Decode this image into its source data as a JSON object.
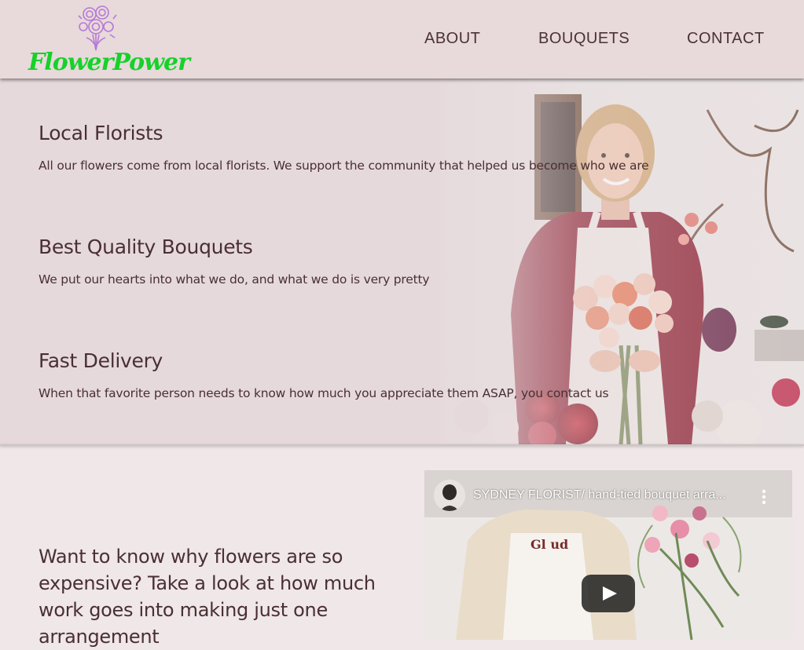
{
  "header": {
    "logo_text": "FlowerPower",
    "nav": [
      {
        "label": "ABOUT"
      },
      {
        "label": "BOUQUETS"
      },
      {
        "label": "CONTACT"
      }
    ]
  },
  "features": [
    {
      "title": "Local Florists",
      "text": "All our flowers come from local florists. We support the community that helped us become who we are"
    },
    {
      "title": "Best Quality Bouquets",
      "text": "We put our hearts into what we do, and what we do is very pretty"
    },
    {
      "title": "Fast Delivery",
      "text": "When that favorite person needs to know how much you appreciate them ASAP, you contact us"
    }
  ],
  "promo": {
    "text": "Want to know why flowers are so expensive? Take a look at how much work goes into making just one arrangement"
  },
  "video": {
    "title": "SYDNEY FLORIST/ hand-tied bouquet arra...",
    "icons": {
      "menu": "more-vert-icon",
      "play": "play-icon",
      "avatar": "channel-avatar"
    }
  },
  "colors": {
    "logo_green": "#17d12b",
    "logo_purple": "#b67ad6",
    "header_bg": "#e8d9da",
    "text": "#4a2f33",
    "page_bg": "#efe7e8"
  }
}
